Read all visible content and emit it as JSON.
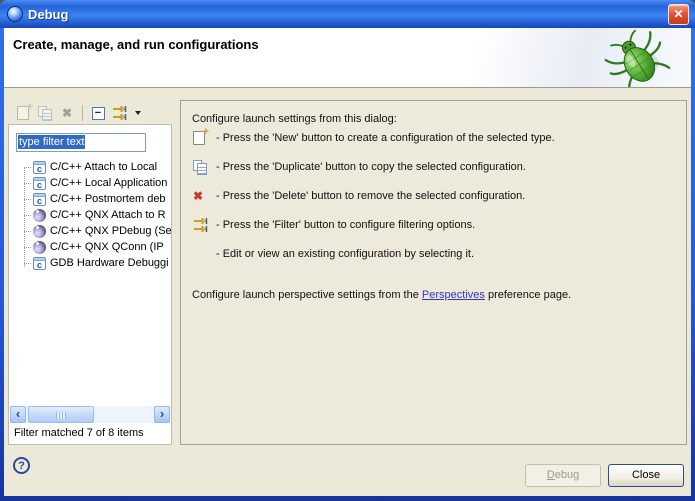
{
  "window": {
    "title": "Debug"
  },
  "header": {
    "title": "Create, manage, and run configurations"
  },
  "icons": {
    "close_glyph": "✕",
    "plus_glyph": "+",
    "minus_glyph": "−",
    "delete_glyph": "✖",
    "c_glyph": "c",
    "scroll_left_glyph": "‹",
    "scroll_right_glyph": "›",
    "help_glyph": "?"
  },
  "toolbar": {
    "buttons": [
      {
        "name": "new-configuration",
        "disabled": true
      },
      {
        "name": "duplicate-configuration",
        "disabled": true
      },
      {
        "name": "delete-configuration",
        "disabled": true
      },
      {
        "name": "collapse-all",
        "disabled": false
      },
      {
        "name": "filter-launch-configurations",
        "disabled": false
      }
    ]
  },
  "filter": {
    "value": "type filter text"
  },
  "tree": {
    "items": [
      {
        "icon": "c-application-icon",
        "label": "C/C++ Attach to Local"
      },
      {
        "icon": "c-application-icon",
        "label": "C/C++ Local Application"
      },
      {
        "icon": "c-application-icon",
        "label": "C/C++ Postmortem deb"
      },
      {
        "icon": "qnx-icon",
        "label": "C/C++ QNX Attach to R"
      },
      {
        "icon": "qnx-icon",
        "label": "C/C++ QNX PDebug (Se"
      },
      {
        "icon": "qnx-icon",
        "label": "C/C++ QNX QConn (IP"
      },
      {
        "icon": "c-application-icon",
        "label": "GDB Hardware Debuggi"
      }
    ]
  },
  "status": {
    "filter_matched": "Filter matched 7 of 8 items"
  },
  "instructions": {
    "intro": "Configure launch settings from this dialog:",
    "items": [
      {
        "icon": "new-icon",
        "text": "- Press the 'New' button to create a configuration of the selected type."
      },
      {
        "icon": "duplicate-icon",
        "text": "- Press the 'Duplicate' button to copy the selected configuration."
      },
      {
        "icon": "delete-icon",
        "text": "- Press the 'Delete' button to remove the selected configuration."
      },
      {
        "icon": "filter-icon",
        "text": "- Press the 'Filter' button to configure filtering options."
      },
      {
        "icon": "none",
        "text": "- Edit or view an existing configuration by selecting it."
      }
    ],
    "perspective_pre": "Configure launch perspective settings from the ",
    "perspective_link": "Perspectives",
    "perspective_post": " preference page."
  },
  "buttons": {
    "debug": "Debug",
    "close": "Close"
  },
  "colors": {
    "titlebar_blue": "#2563d8",
    "dialog_bg": "#ece9d8",
    "selection_blue": "#316ac5",
    "link_blue": "#3333cc",
    "close_button_red": "#d6492a",
    "bug_green": "#57ae35",
    "disabled_text": "#9d9a88",
    "input_border": "#7f9db9"
  }
}
